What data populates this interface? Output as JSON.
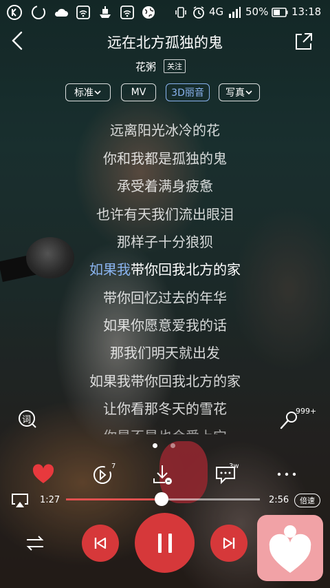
{
  "status_bar": {
    "battery_percent": "50%",
    "time": "13:18",
    "network": "4G",
    "icons": [
      "k-app-icon",
      "loading-circle-icon",
      "cloud-icon",
      "wifi-app-icon",
      "ship-app-icon",
      "wifi-app-icon",
      "globe-icon",
      "vibrate-icon",
      "alarm-icon",
      "signal-icon",
      "battery-icon"
    ]
  },
  "song": {
    "title": "远在北方孤独的鬼",
    "artist": "花粥",
    "follow_label": "关注"
  },
  "options": {
    "quality": "标准",
    "mv": "MV",
    "sound": "3D丽音",
    "photo": "写真"
  },
  "lyrics": [
    "远离阳光冰冷的花",
    "你和我都是孤独的鬼",
    "承受着满身疲惫",
    "也许有天我们流出眼泪",
    "那样子十分狼狈",
    "如果我带你回我北方的家",
    "带你回忆过去的年华",
    "如果你愿意爱我的话",
    "那我们明天就出发",
    "如果我带你回我北方的家",
    "让你看那冬天的雪花",
    "你是不是也会爱上它"
  ],
  "current_lyric": {
    "sung": "如果我",
    "rest": "带你回我北方的家"
  },
  "side": {
    "lyrics_icon_label": "词",
    "ktv_count": "999+"
  },
  "actions": {
    "share_count": "7",
    "comment_count": "3w"
  },
  "progress": {
    "current": "1:27",
    "total": "2:56",
    "fraction": 0.494,
    "speed_label": "倍速"
  },
  "colors": {
    "accent_red": "#d6383a",
    "highlight_blue": "#8ab4f0",
    "progress_red": "#e0504f"
  }
}
